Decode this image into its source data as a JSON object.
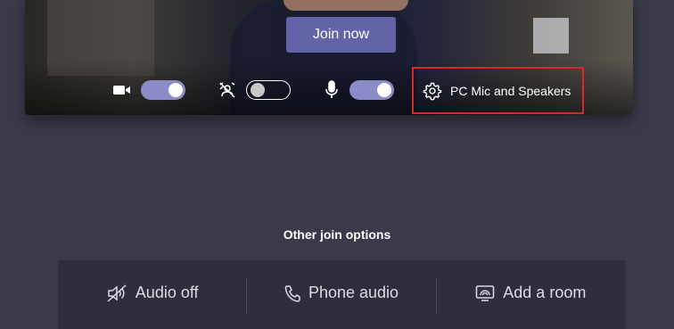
{
  "preview": {
    "join_label": "Join now",
    "controls": {
      "camera": {
        "icon": "video-camera-icon",
        "state": "on"
      },
      "background": {
        "icon": "background-blur-icon",
        "state": "off"
      },
      "microphone": {
        "icon": "microphone-icon",
        "state": "on"
      }
    },
    "device": {
      "icon": "gear-icon",
      "label": "PC Mic and Speakers",
      "highlight_color": "#d9272e"
    }
  },
  "other_join": {
    "title": "Other join options",
    "options": [
      {
        "icon": "speaker-off-icon",
        "label": "Audio off"
      },
      {
        "icon": "phone-icon",
        "label": "Phone audio"
      },
      {
        "icon": "cast-screen-icon",
        "label": "Add a room"
      }
    ]
  },
  "colors": {
    "background": "#3b3a4a",
    "accent": "#6264a7",
    "toggle_on": "#8b8cc7",
    "panel": "#2f2e3d"
  }
}
